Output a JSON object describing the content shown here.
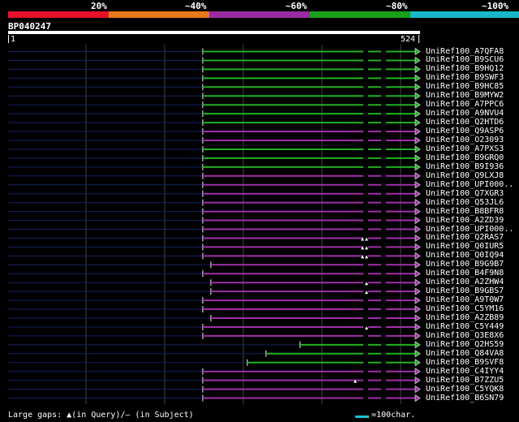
{
  "legend": {
    "labels": [
      "20%",
      "~40%",
      "~60%",
      "~80%",
      "~100%"
    ],
    "colors": [
      "#e8102a",
      "#e87818",
      "#9a2aa0",
      "#18a018",
      "#18b8c8"
    ]
  },
  "query": {
    "name": "BP040247",
    "start": "1",
    "end": "524",
    "length": 524
  },
  "footer": {
    "gaps_text": "Large gaps: ▲(in Query)/– (in Subject)",
    "scale_text": "=100char."
  },
  "hits": [
    {
      "name": "UniRef100_A7QFA8",
      "color": "green",
      "start": 250
    },
    {
      "name": "UniRef100_B9SCU6",
      "color": "green",
      "start": 250
    },
    {
      "name": "UniRef100_B9HQ12",
      "color": "green",
      "start": 250
    },
    {
      "name": "UniRef100_B9SWF3",
      "color": "green",
      "start": 250
    },
    {
      "name": "UniRef100_B9HC85",
      "color": "green",
      "start": 250
    },
    {
      "name": "UniRef100_B9MYW2",
      "color": "green",
      "start": 250
    },
    {
      "name": "UniRef100_A7PPC6",
      "color": "green",
      "start": 250
    },
    {
      "name": "UniRef100_A9NVU4",
      "color": "green",
      "start": 250
    },
    {
      "name": "UniRef100_Q2HTD6",
      "color": "green",
      "start": 250
    },
    {
      "name": "UniRef100_Q9ASP6",
      "color": "purple",
      "start": 250
    },
    {
      "name": "UniRef100_O23093",
      "color": "purple",
      "start": 250
    },
    {
      "name": "UniRef100_A7PXS3",
      "color": "green",
      "start": 250
    },
    {
      "name": "UniRef100_B9GRQ0",
      "color": "green",
      "start": 250
    },
    {
      "name": "UniRef100_B9I936",
      "color": "green",
      "start": 250
    },
    {
      "name": "UniRef100_Q9LXJ8",
      "color": "purple",
      "start": 250
    },
    {
      "name": "UniRef100_UPI000..",
      "color": "purple",
      "start": 250
    },
    {
      "name": "UniRef100_Q7XGR3",
      "color": "purple",
      "start": 250
    },
    {
      "name": "UniRef100_Q53JL6",
      "color": "purple",
      "start": 250
    },
    {
      "name": "UniRef100_B8BFR8",
      "color": "purple",
      "start": 250
    },
    {
      "name": "UniRef100_A2ZD39",
      "color": "purple",
      "start": 250
    },
    {
      "name": "UniRef100_UPI000..",
      "color": "purple",
      "start": 250
    },
    {
      "name": "UniRef100_Q2RAS7",
      "color": "purple",
      "start": 250
    },
    {
      "name": "UniRef100_Q0IUR5",
      "color": "purple",
      "start": 250
    },
    {
      "name": "UniRef100_Q0IQ94",
      "color": "purple",
      "start": 250
    },
    {
      "name": "UniRef100_B9G9B7",
      "color": "purple",
      "start": 260
    },
    {
      "name": "UniRef100_B4F9N8",
      "color": "purple",
      "start": 250
    },
    {
      "name": "UniRef100_A2ZHW4",
      "color": "purple",
      "start": 260
    },
    {
      "name": "UniRef100_B9GBS7",
      "color": "purple",
      "start": 260
    },
    {
      "name": "UniRef100_A9T0W7",
      "color": "purple",
      "start": 250
    },
    {
      "name": "UniRef100_C5YM16",
      "color": "purple",
      "start": 250
    },
    {
      "name": "UniRef100_A2ZB89",
      "color": "purple",
      "start": 260
    },
    {
      "name": "UniRef100_C5Y449",
      "color": "purple",
      "start": 250
    },
    {
      "name": "UniRef100_Q3E8X6",
      "color": "purple",
      "start": 250
    },
    {
      "name": "UniRef100_Q2HS59",
      "color": "green",
      "start": 370
    },
    {
      "name": "UniRef100_Q84VA8",
      "color": "green",
      "start": 328
    },
    {
      "name": "UniRef100_B9SVF8",
      "color": "green",
      "start": 305
    },
    {
      "name": "UniRef100_C4IYY4",
      "color": "purple",
      "start": 250
    },
    {
      "name": "UniRef100_B7ZZU5",
      "color": "purple",
      "start": 250
    },
    {
      "name": "UniRef100_C5YQK8",
      "color": "purple",
      "start": 250
    },
    {
      "name": "UniRef100_B6SN79",
      "color": "purple",
      "start": 250
    }
  ]
}
